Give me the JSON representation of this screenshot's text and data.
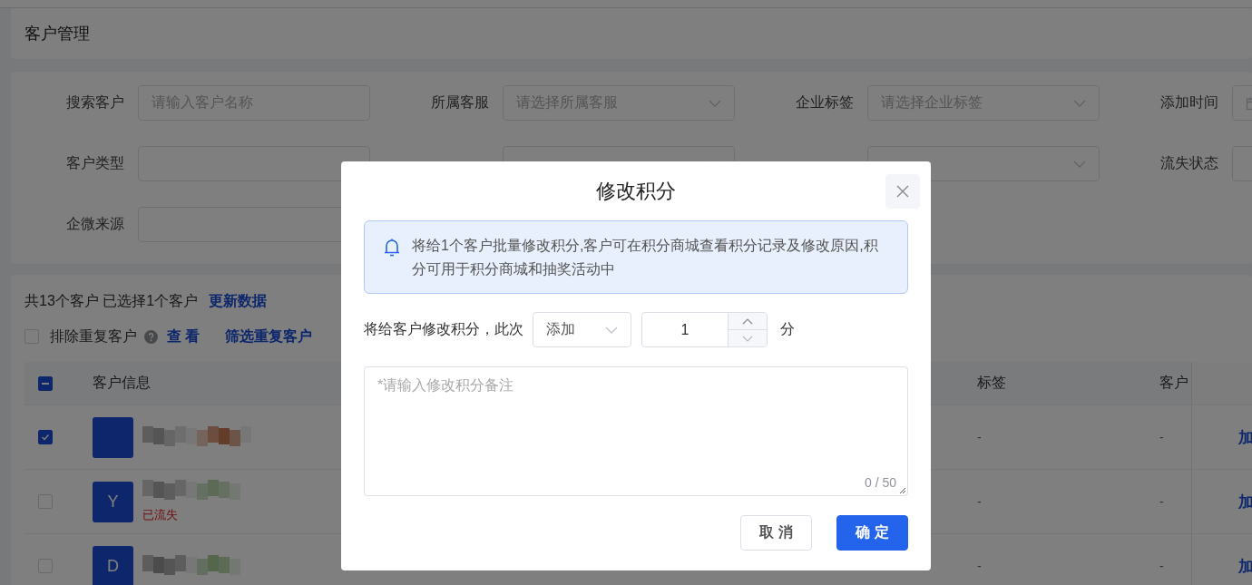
{
  "page_title": "客户管理",
  "filters": [
    {
      "label": "搜索客户",
      "kind": "input",
      "placeholder": "请输入客户名称"
    },
    {
      "label": "所属客服",
      "kind": "select",
      "placeholder": "请选择所属客服"
    },
    {
      "label": "企业标签",
      "kind": "select",
      "placeholder": "请选择企业标签"
    },
    {
      "label": "添加时间",
      "kind": "date"
    },
    {
      "label": "客户类型",
      "kind": "select"
    },
    {
      "kind": "select"
    },
    {
      "kind": "select"
    },
    {
      "label": "流失状态",
      "kind": "input"
    },
    {
      "label": "企微来源",
      "kind": "input"
    }
  ],
  "summary": {
    "text": "共13个客户 已选择1个客户",
    "link": "更新数据"
  },
  "dedupe": {
    "checked": false,
    "label": "排除重复客户",
    "view_link": "查 看",
    "filter_link": "筛选重复客户"
  },
  "table": {
    "select_all": {
      "indeterminate": true
    },
    "columns": [
      "客户信息",
      "标签",
      "客户"
    ],
    "rows": [
      {
        "selected": true,
        "tags": "-",
        "type": "-",
        "action": "加"
      },
      {
        "selected": false,
        "avatar": "Y",
        "status": "已流失",
        "tags": "-",
        "type": "-",
        "action": "加"
      },
      {
        "selected": false,
        "avatar": "D",
        "tags": "-",
        "type": "-",
        "action": "加"
      }
    ]
  },
  "dialog": {
    "title": "修改积分",
    "notice": "将给1个客户批量修改积分,客户可在积分商城查看积分记录及修改原因,积分可用于积分商城和抽奖活动中",
    "prompt": "将给客户修改积分，此次",
    "operation": "添加",
    "amount": "1",
    "unit": "分",
    "remark_placeholder": "*请输入修改积分备注",
    "counter": "0 / 50",
    "buttons": [
      {
        "label": "取 消",
        "kind": "secondary"
      },
      {
        "label": "确 定",
        "kind": "primary"
      }
    ]
  }
}
